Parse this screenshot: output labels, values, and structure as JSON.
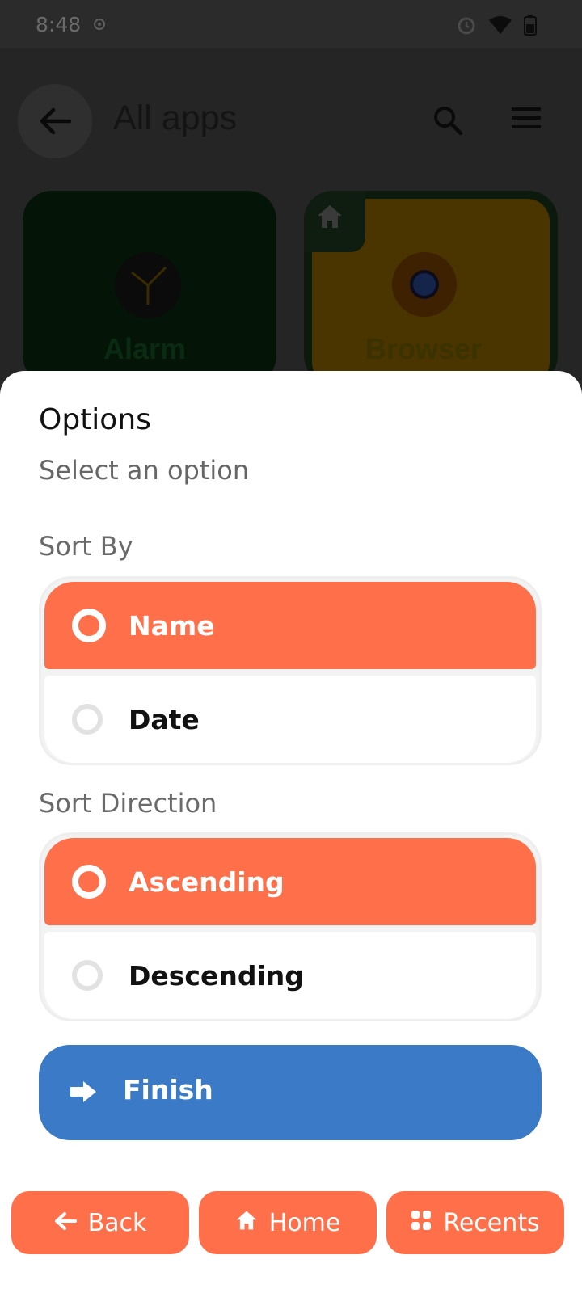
{
  "status_bar": {
    "time": "8:48"
  },
  "app_bar": {
    "title": "All apps"
  },
  "apps": [
    {
      "label": "Alarm"
    },
    {
      "label": "Browser"
    }
  ],
  "sheet": {
    "title": "Options",
    "subtitle": "Select an option",
    "sort_by": {
      "label": "Sort By",
      "options": [
        {
          "label": "Name",
          "selected": true
        },
        {
          "label": "Date",
          "selected": false
        }
      ]
    },
    "sort_direction": {
      "label": "Sort Direction",
      "options": [
        {
          "label": "Ascending",
          "selected": true
        },
        {
          "label": "Descending",
          "selected": false
        }
      ]
    },
    "finish_label": "Finish"
  },
  "nav": {
    "back": "Back",
    "home": "Home",
    "recents": "Recents"
  },
  "colors": {
    "accent": "#ff6f49",
    "primary_button": "#3a7ac6"
  }
}
